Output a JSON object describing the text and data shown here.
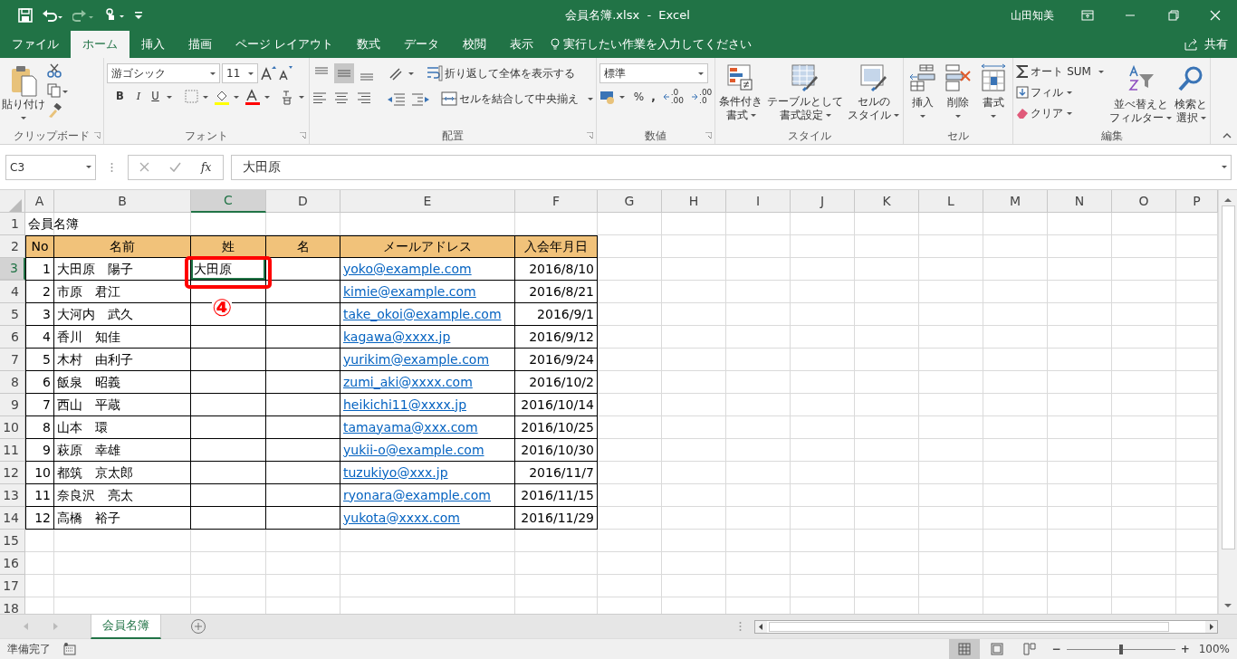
{
  "title_bar": {
    "title": "会員名簿.xlsx  -  Excel",
    "user": "山田知美"
  },
  "ribbon_tabs": [
    {
      "label": "ファイル",
      "selected": false
    },
    {
      "label": "ホーム",
      "selected": true
    },
    {
      "label": "挿入",
      "selected": false
    },
    {
      "label": "描画",
      "selected": false
    },
    {
      "label": "ページ レイアウト",
      "selected": false
    },
    {
      "label": "数式",
      "selected": false
    },
    {
      "label": "データ",
      "selected": false
    },
    {
      "label": "校閲",
      "selected": false
    },
    {
      "label": "表示",
      "selected": false
    }
  ],
  "tell_me": "実行したい作業を入力してください",
  "share": "共有",
  "clipboard": {
    "paste": "貼り付け",
    "label": "クリップボード"
  },
  "font": {
    "name": "游ゴシック",
    "size": "11",
    "bold": "B",
    "italic": "I",
    "underline": "U",
    "label": "フォント"
  },
  "alignment": {
    "wrap": "折り返して全体を表示する",
    "merge": "セルを結合して中央揃え",
    "label": "配置"
  },
  "number": {
    "format": "標準",
    "percent": "%",
    "comma": ",",
    "increase_decimal": [
      ".0",
      ".00"
    ],
    "decrease_decimal": [
      ".00",
      ".0"
    ],
    "label": "数値"
  },
  "styles": {
    "buttons": [
      {
        "kind": "conditional",
        "lines": [
          "条件付き",
          "書式"
        ]
      },
      {
        "kind": "table",
        "lines": [
          "テーブルとして",
          "書式設定"
        ]
      },
      {
        "kind": "cell_style",
        "lines": [
          "セルの",
          "スタイル"
        ]
      }
    ],
    "label": "スタイル"
  },
  "cells": {
    "buttons": [
      {
        "kind": "insert",
        "label": "挿入"
      },
      {
        "kind": "delete",
        "label": "削除"
      },
      {
        "kind": "format",
        "label": "書式"
      }
    ],
    "label": "セル"
  },
  "editing": {
    "autosum": "オート SUM",
    "fill": "フィル",
    "clear": "クリア",
    "sort": [
      "並べ替えと",
      "フィルター"
    ],
    "find": [
      "検索と",
      "選択"
    ],
    "label": "編集"
  },
  "formula_bar": {
    "name_box": "C3",
    "fx": "fx",
    "value": "大田原"
  },
  "sheet": {
    "columns": [
      {
        "label": "A",
        "selected": false
      },
      {
        "label": "B",
        "selected": false
      },
      {
        "label": "C",
        "selected": true
      },
      {
        "label": "D",
        "selected": false
      },
      {
        "label": "E",
        "selected": false
      },
      {
        "label": "F",
        "selected": false
      },
      {
        "label": "G",
        "selected": false
      },
      {
        "label": "H",
        "selected": false
      },
      {
        "label": "I",
        "selected": false
      },
      {
        "label": "J",
        "selected": false
      },
      {
        "label": "K",
        "selected": false
      },
      {
        "label": "L",
        "selected": false
      },
      {
        "label": "M",
        "selected": false
      },
      {
        "label": "N",
        "selected": false
      },
      {
        "label": "O",
        "selected": false
      },
      {
        "label": "P",
        "selected": false
      }
    ],
    "rows": [
      {
        "number": "1",
        "kind": "title",
        "selected": false,
        "title": "会員名簿"
      },
      {
        "number": "2",
        "kind": "header",
        "selected": false,
        "headers": [
          "No",
          "名前",
          "姓",
          "名",
          "メールアドレス",
          "入会年月日"
        ]
      },
      {
        "number": "3",
        "kind": "data",
        "selected": true,
        "no": "1",
        "name": "大田原　陽子",
        "last": "大田原",
        "email": "yoko@example.com",
        "joined": "2016/8/10"
      },
      {
        "number": "4",
        "kind": "data",
        "selected": false,
        "no": "2",
        "name": "市原　君江",
        "email": "kimie@example.com",
        "joined": "2016/8/21"
      },
      {
        "number": "5",
        "kind": "data",
        "selected": false,
        "no": "3",
        "name": "大河内　武久",
        "email": "take_okoi@example.com",
        "joined": "2016/9/1"
      },
      {
        "number": "6",
        "kind": "data",
        "selected": false,
        "no": "4",
        "name": "香川　知佳",
        "email": "kagawa@xxxx.jp",
        "joined": "2016/9/12"
      },
      {
        "number": "7",
        "kind": "data",
        "selected": false,
        "no": "5",
        "name": "木村　由利子",
        "email": "yurikim@example.com",
        "joined": "2016/9/24"
      },
      {
        "number": "8",
        "kind": "data",
        "selected": false,
        "no": "6",
        "name": "飯泉　昭義",
        "email": "zumi_aki@xxxx.com",
        "joined": "2016/10/2"
      },
      {
        "number": "9",
        "kind": "data",
        "selected": false,
        "no": "7",
        "name": "西山　平蔵",
        "email": "heikichi11@xxxx.jp",
        "joined": "2016/10/14"
      },
      {
        "number": "10",
        "kind": "data",
        "selected": false,
        "no": "8",
        "name": "山本　環",
        "email": "tamayama@xxx.com",
        "joined": "2016/10/25"
      },
      {
        "number": "11",
        "kind": "data",
        "selected": false,
        "no": "9",
        "name": "萩原　幸雄",
        "email": "yukii-o@example.com",
        "joined": "2016/10/30"
      },
      {
        "number": "12",
        "kind": "data",
        "selected": false,
        "no": "10",
        "name": "都筑　京太郎",
        "email": "tuzukiyo@xxx.jp",
        "joined": "2016/11/7"
      },
      {
        "number": "13",
        "kind": "data",
        "selected": false,
        "no": "11",
        "name": "奈良沢　亮太",
        "email": "ryonara@example.com",
        "joined": "2016/11/15"
      },
      {
        "number": "14",
        "kind": "data",
        "selected": false,
        "no": "12",
        "name": "高橋　裕子",
        "email": "yukota@xxxx.com",
        "joined": "2016/11/29"
      },
      {
        "number": "15",
        "kind": "empty",
        "selected": false
      },
      {
        "number": "16",
        "kind": "empty",
        "selected": false
      },
      {
        "number": "17",
        "kind": "empty",
        "selected": false
      },
      {
        "number": "18",
        "kind": "empty",
        "selected": false
      }
    ]
  },
  "annotation": {
    "label": "④"
  },
  "sheet_tabs": [
    {
      "label": "会員名簿",
      "selected": true
    }
  ],
  "status_bar": {
    "status": "準備完了",
    "views": [
      {
        "kind": "normal",
        "selected": true
      },
      {
        "kind": "page_layout",
        "selected": false
      },
      {
        "kind": "page_break",
        "selected": false
      }
    ],
    "zoom_out": "−",
    "zoom_in": "+",
    "zoom": {
      "level": 0.5
    },
    "zoom_label": "100%"
  }
}
